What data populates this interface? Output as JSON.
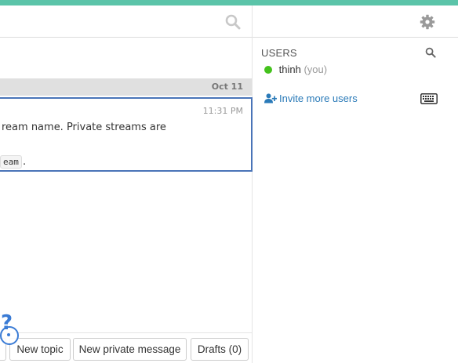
{
  "header": {
    "search_icon": "search-icon",
    "settings_icon": "gear-icon",
    "accent_color": "#5bc4a9"
  },
  "message_list": {
    "date_label": "Oct 11",
    "message": {
      "time": "11:31 PM",
      "text_line1": "ream name. Private streams are",
      "code_snippet": "eam",
      "trailing_text": "."
    },
    "selected_border_color": "#4a74b8"
  },
  "compose": {
    "new_topic_label": "New topic",
    "new_pm_label": "New private message",
    "drafts_label": "Drafts (0)",
    "help_glyph": "?"
  },
  "right_sidebar": {
    "users_title": "USERS",
    "users_search_icon": "search-icon",
    "users": [
      {
        "name": "thinh",
        "suffix": "(you)",
        "status": "active",
        "status_color": "#44c21d"
      }
    ],
    "invite_label": "Invite more users",
    "invite_icon": "user-plus-icon",
    "keyboard_icon": "keyboard-icon",
    "link_color": "#2a7ab8"
  }
}
